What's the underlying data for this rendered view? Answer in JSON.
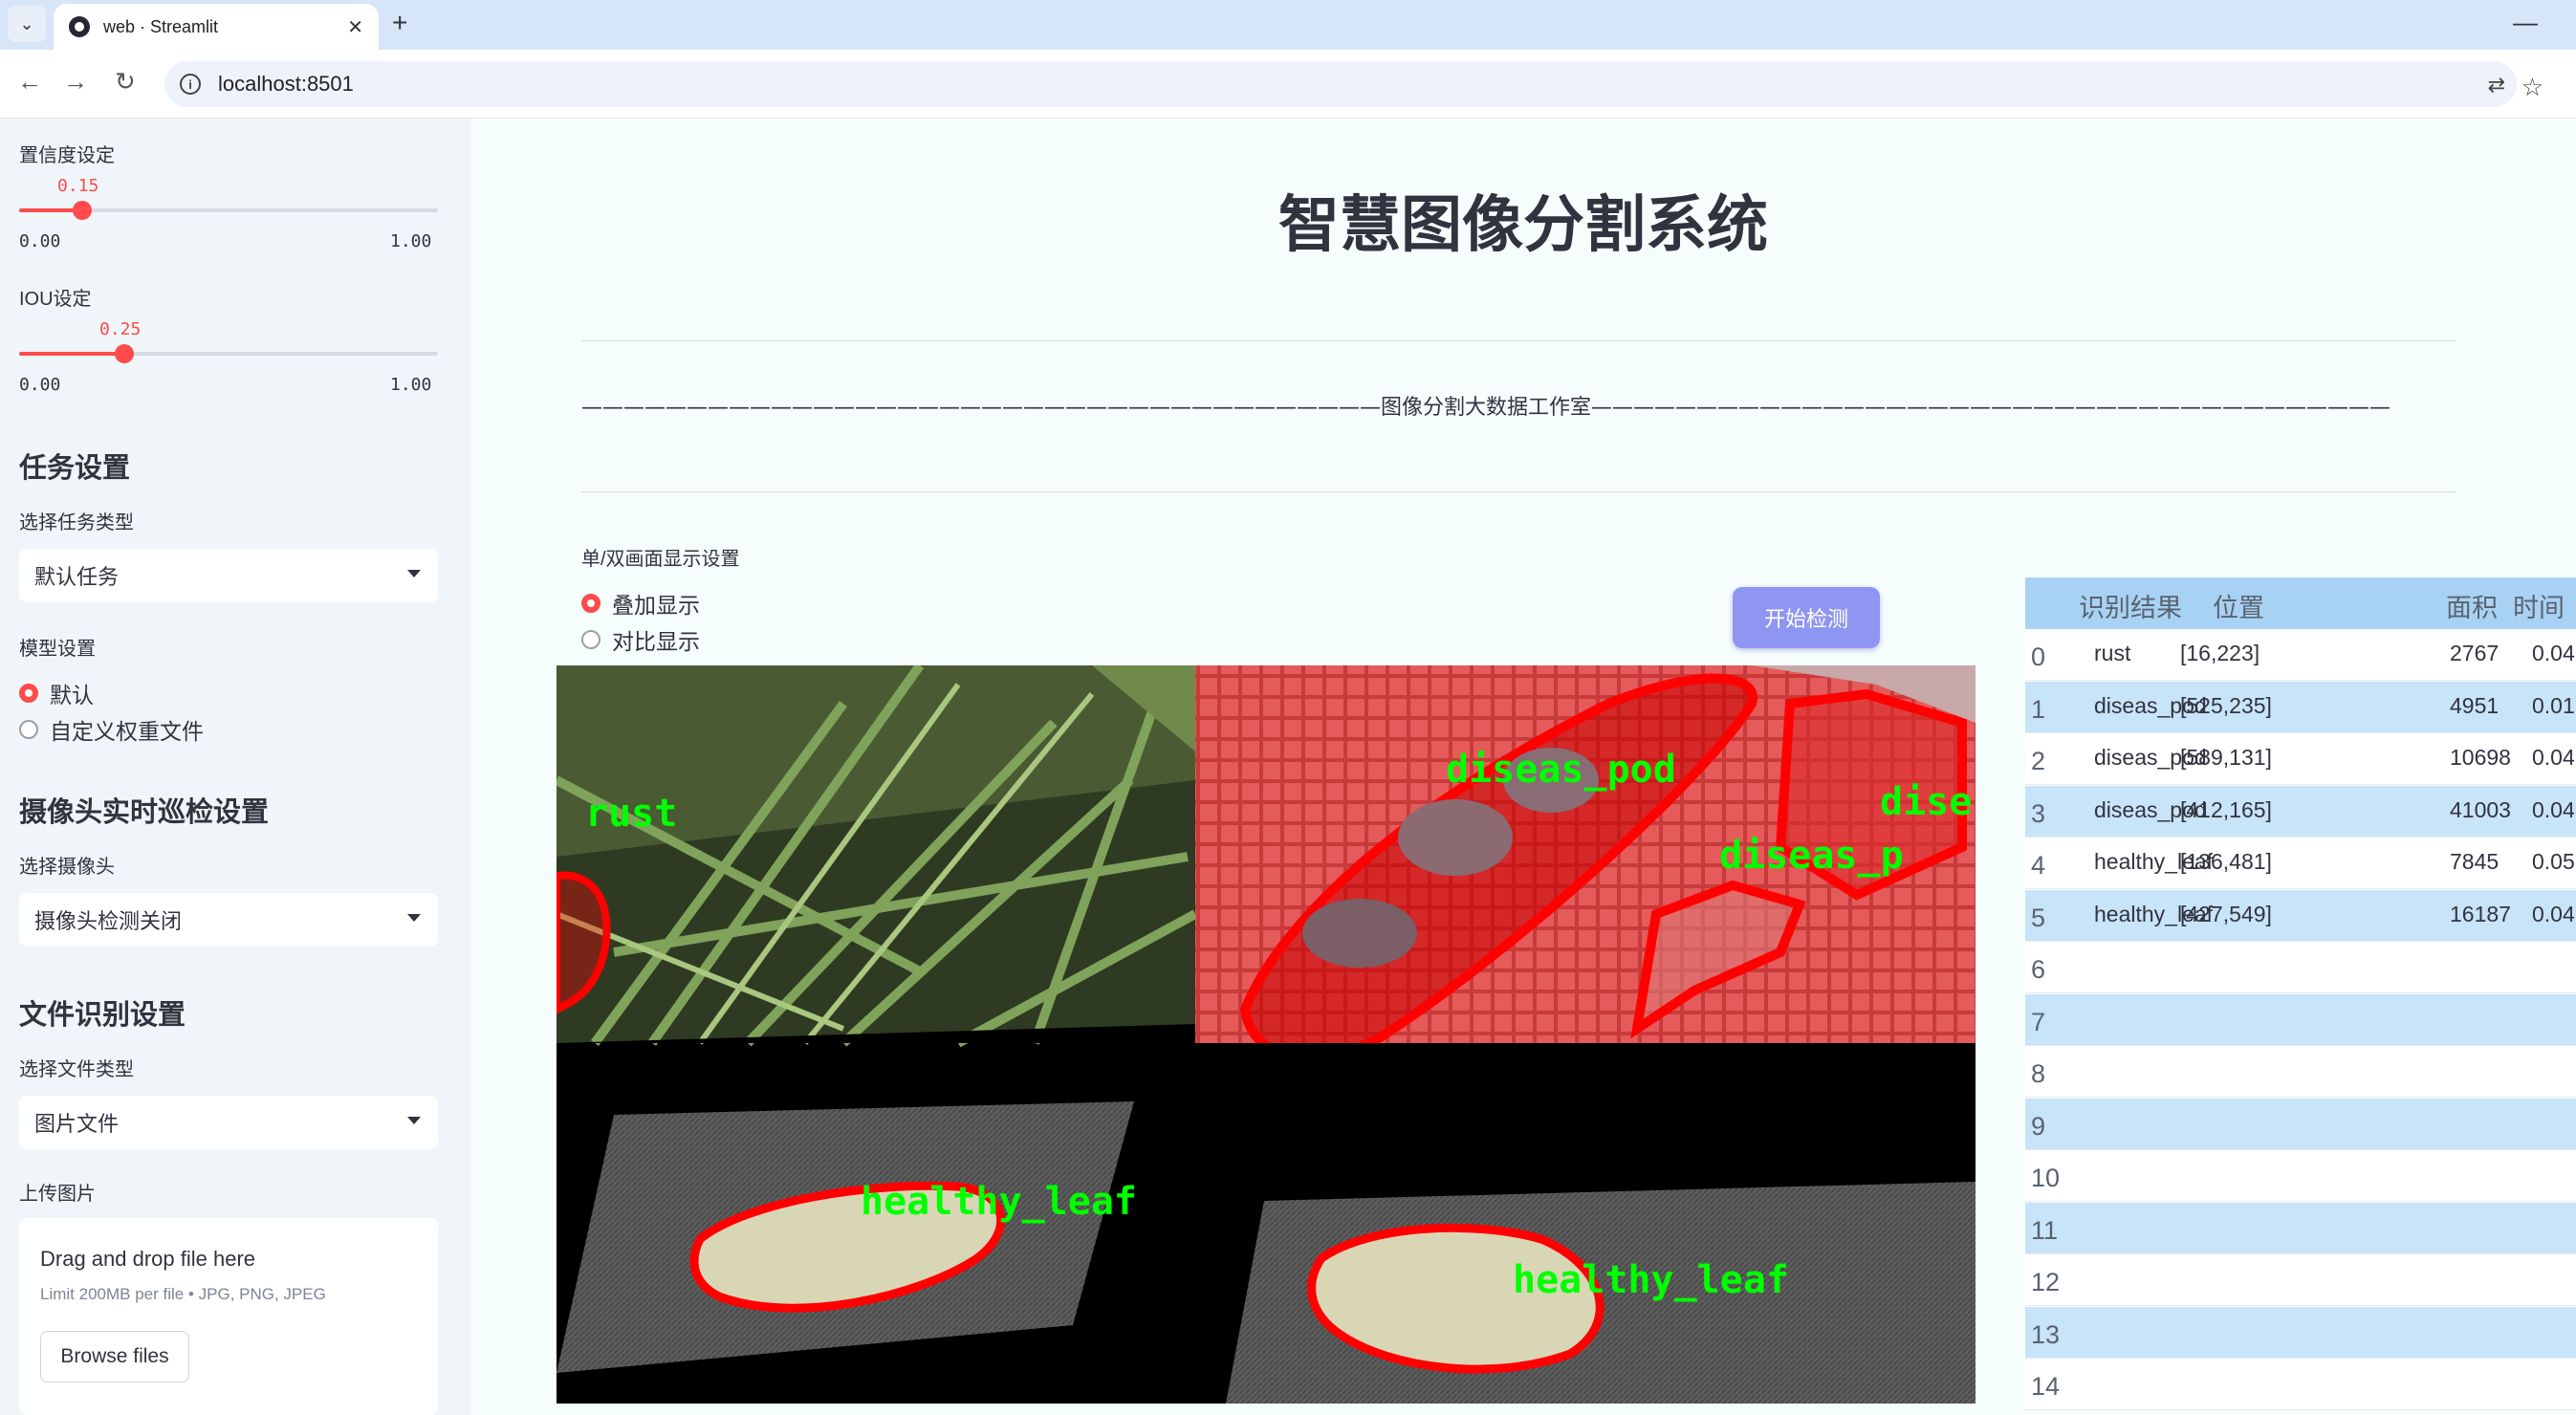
{
  "browser": {
    "tab_title": "web · Streamlit",
    "url": "localhost:8501"
  },
  "sidebar": {
    "confidence": {
      "label": "置信度设定",
      "value": "0.15",
      "min": "0.00",
      "max": "1.00",
      "fraction": 0.15
    },
    "iou": {
      "label": "IOU设定",
      "value": "0.25",
      "min": "0.00",
      "max": "1.00",
      "fraction": 0.25
    },
    "task_heading": "任务设置",
    "task_type_label": "选择任务类型",
    "task_type_value": "默认任务",
    "model_label": "模型设置",
    "model_options": [
      "默认",
      "自定义权重文件"
    ],
    "model_selected": 0,
    "camera_heading": "摄像头实时巡检设置",
    "camera_label": "选择摄像头",
    "camera_value": "摄像头检测关闭",
    "file_heading": "文件识别设置",
    "file_type_label": "选择文件类型",
    "file_type_value": "图片文件",
    "upload_label": "上传图片",
    "dropzone_title": "Drag and drop file here",
    "dropzone_limit": "Limit 200MB per file • JPG, PNG, JPEG",
    "browse_label": "Browse files"
  },
  "main": {
    "title": "智慧图像分割系统",
    "studio_line": "——————————————————————————————————————图像分割大数据工作室——————————————————————————————————————",
    "display_label": "单/双画面显示设置",
    "display_options": [
      "叠加显示",
      "对比显示"
    ],
    "display_selected": 0,
    "start_button": "开始检测",
    "detections_overlay": [
      "rust",
      "diseas_pod",
      "dise",
      "diseas_p",
      "healthy_leaf",
      "healthy_leaf"
    ]
  },
  "table": {
    "headers": [
      "识别结果",
      "位置",
      "面积",
      "时间"
    ],
    "rows": [
      {
        "idx": "0",
        "label": "rust",
        "pos": "[16,223]",
        "area": "2767",
        "time": "0.04"
      },
      {
        "idx": "1",
        "label": "diseas_pod",
        "pos": "[525,235]",
        "area": "4951",
        "time": "0.01"
      },
      {
        "idx": "2",
        "label": "diseas_pod",
        "pos": "[589,131]",
        "area": "10698",
        "time": "0.04"
      },
      {
        "idx": "3",
        "label": "diseas_pod",
        "pos": "[412,165]",
        "area": "41003",
        "time": "0.04"
      },
      {
        "idx": "4",
        "label": "healthy_leaf",
        "pos": "[136,481]",
        "area": "7845",
        "time": "0.05"
      },
      {
        "idx": "5",
        "label": "healthy_leaf",
        "pos": "[427,549]",
        "area": "16187",
        "time": "0.04"
      },
      {
        "idx": "6",
        "label": "",
        "pos": "",
        "area": "",
        "time": ""
      },
      {
        "idx": "7",
        "label": "",
        "pos": "",
        "area": "",
        "time": ""
      },
      {
        "idx": "8",
        "label": "",
        "pos": "",
        "area": "",
        "time": ""
      },
      {
        "idx": "9",
        "label": "",
        "pos": "",
        "area": "",
        "time": ""
      },
      {
        "idx": "10",
        "label": "",
        "pos": "",
        "area": "",
        "time": ""
      },
      {
        "idx": "11",
        "label": "",
        "pos": "",
        "area": "",
        "time": ""
      },
      {
        "idx": "12",
        "label": "",
        "pos": "",
        "area": "",
        "time": ""
      },
      {
        "idx": "13",
        "label": "",
        "pos": "",
        "area": "",
        "time": ""
      },
      {
        "idx": "14",
        "label": "",
        "pos": "",
        "area": "",
        "time": ""
      }
    ]
  },
  "colors": {
    "accent": "#ff4b4b",
    "button": "#8e96f2",
    "table_header": "#a8d2f4",
    "table_alt": "#c8e4f9",
    "mask_red": "#ff0000",
    "label_green": "#00ff00"
  }
}
